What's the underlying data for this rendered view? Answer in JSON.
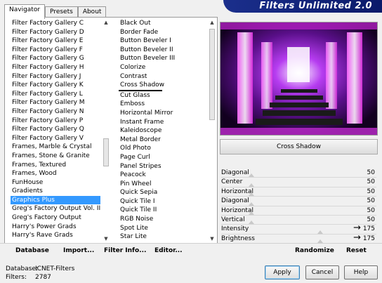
{
  "app": {
    "title": "Filters Unlimited 2.0"
  },
  "tabs": [
    {
      "label": "Navigator",
      "active": true
    },
    {
      "label": "Presets",
      "active": false
    },
    {
      "label": "About",
      "active": false
    }
  ],
  "categories": [
    "Filter Factory Gallery C",
    "Filter Factory Gallery D",
    "Filter Factory Gallery E",
    "Filter Factory Gallery F",
    "Filter Factory Gallery G",
    "Filter Factory Gallery H",
    "Filter Factory Gallery J",
    "Filter Factory Gallery K",
    "Filter Factory Gallery L",
    "Filter Factory Gallery M",
    "Filter Factory Gallery N",
    "Filter Factory Gallery P",
    "Filter Factory Gallery Q",
    "Filter Factory Gallery V",
    "Frames, Marble & Crystal",
    "Frames, Stone & Granite",
    "Frames, Textured",
    "Frames, Wood",
    "FunHouse",
    "Gradients",
    "Graphics Plus",
    "Greg's Factory Output Vol. II",
    "Greg's Factory Output",
    "Harry's Power Grads",
    "Harry's Rave Grads"
  ],
  "selected_category": "Graphics Plus",
  "filters": [
    "Black Out",
    "Border Fade",
    "Button Beveler I",
    "Button Beveler II",
    "Button Beveler III",
    "Colorize",
    "Contrast",
    "Cross Shadow",
    "Cut Glass",
    "Emboss",
    "Horizontal Mirror",
    "Instant Frame",
    "Kaleidoscope",
    "Metal Border",
    "Old Photo",
    "Page Curl",
    "Panel Stripes",
    "Peacock",
    "Pin Wheel",
    "Quick Sepia",
    "Quick Tile I",
    "Quick Tile II",
    "RGB Noise",
    "Spot Lite",
    "Star Lite"
  ],
  "selected_filter": "Cross Shadow",
  "filter_name": "Cross Shadow",
  "parameters": [
    {
      "label": "Diagonal",
      "value": "50",
      "level": 0.196
    },
    {
      "label": "Center",
      "value": "50",
      "level": 0.196
    },
    {
      "label": "Horizontal",
      "value": "50",
      "level": 0.196
    },
    {
      "label": "Diagonal",
      "value": "50",
      "level": 0.196
    },
    {
      "label": "Horizontal",
      "value": "50",
      "level": 0.196
    },
    {
      "label": "Vertical",
      "value": "50",
      "level": 0.196
    },
    {
      "label": "Intensity",
      "value": "175",
      "level": 0.686,
      "arrow": true
    },
    {
      "label": "Brightness",
      "value": "175",
      "level": 0.686,
      "arrow": true
    }
  ],
  "actions": {
    "database": "Database",
    "import": "Import...",
    "filter_info": "Filter Info...",
    "editor": "Editor...",
    "randomize": "Randomize",
    "reset": "Reset"
  },
  "status": {
    "database_label": "Database:",
    "database_value": "ICNET-Filters",
    "filters_label": "Filters:",
    "filters_value": "2787"
  },
  "buttons": {
    "apply": "Apply",
    "cancel": "Cancel",
    "help": "Help"
  },
  "colors": {
    "selection": "#3399ff",
    "banner": "#1b2f8c",
    "preview_accent": "#e040e0"
  }
}
